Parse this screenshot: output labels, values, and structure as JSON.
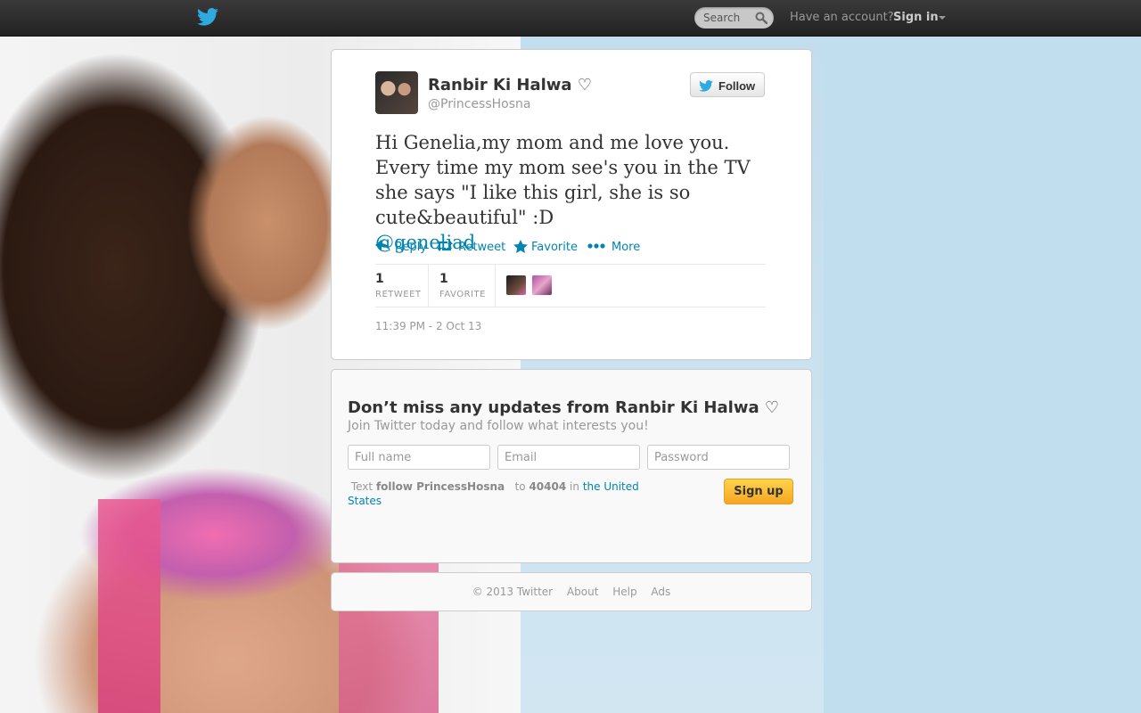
{
  "topbar": {
    "search_placeholder": "Search",
    "have_account": "Have an account?",
    "sign_in": "Sign in"
  },
  "tweet": {
    "fullname": "Ranbir Ki Halwa ♡",
    "screenname": "@PrincessHosna",
    "follow_label": "Follow",
    "text": "Hi Genelia,my mom and me love you. Every time my mom see's you in the TV she says \"I like this girl, she is so cute&beautiful\" :D",
    "mention": "@geneliad",
    "actions": {
      "reply": "Reply",
      "retweet": "Retweet",
      "favorite": "Favorite",
      "more": "More"
    },
    "stats": {
      "retweets_count": "1",
      "retweets_label": "RETWEET",
      "favorites_count": "1",
      "favorites_label": "FAVORITE"
    },
    "timestamp": "11:39 PM - 2 Oct 13"
  },
  "signup": {
    "title": "Don’t miss any updates from Ranbir Ki Halwa ♡",
    "subtitle": "Join Twitter today and follow what interests you!",
    "fullname_placeholder": "Full name",
    "email_placeholder": "Email",
    "password_placeholder": "Password",
    "sms_text": "Text",
    "sms_command": "follow PrincessHosna",
    "sms_to": "to",
    "sms_number": "40404",
    "sms_in": "in",
    "sms_country": "the United States",
    "button": "Sign up"
  },
  "footer": {
    "copyright": "© 2013 Twitter",
    "about": "About",
    "help": "Help",
    "ads": "Ads"
  },
  "colors": {
    "link": "#0084b4",
    "background": "#c0deed",
    "signup_button": "#f5a623"
  }
}
